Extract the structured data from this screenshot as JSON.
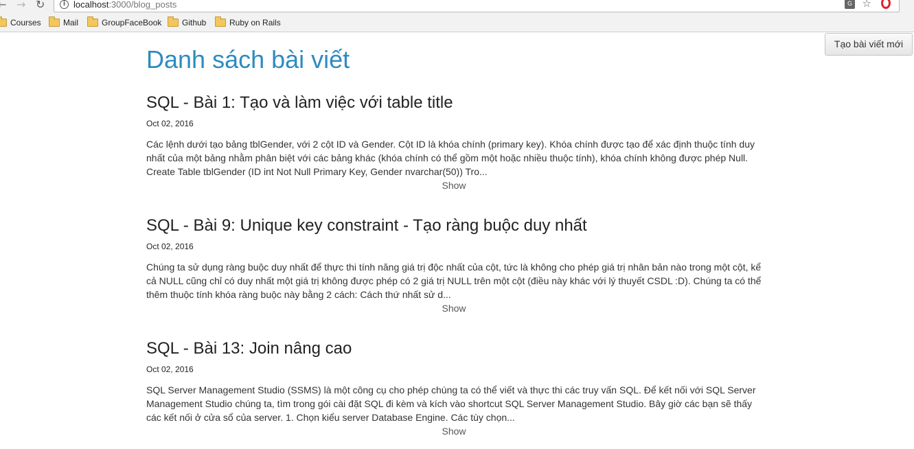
{
  "browser": {
    "url_host": "localhost",
    "url_path": ":3000/blog_posts",
    "bookmarks": [
      "Courses",
      "Mail",
      "GroupFaceBook",
      "Github",
      "Ruby on Rails"
    ]
  },
  "page": {
    "title": "Danh sách bài viết",
    "new_post_button": "Tạo bài viết mới",
    "title_color": "#2e8bc0"
  },
  "posts": [
    {
      "title": "SQL - Bài 1: Tạo và làm việc với table title",
      "date": "Oct 02, 2016",
      "excerpt": "Các lệnh dưới tạo bảng tblGender, với 2 cột ID và Gender. Cột ID là khóa chính (primary key). Khóa chính được tạo để xác định thuộc tính duy nhất của một bảng nhằm phân biệt với các bảng khác (khóa chính có thể gồm một hoặc nhiều thuộc tính), khóa chính không được phép Null. Create Table tblGender (ID int Not Null Primary Key, Gender nvarchar(50)) Tro...",
      "show": "Show"
    },
    {
      "title": "SQL - Bài 9: Unique key constraint - Tạo ràng buộc duy nhất",
      "date": "Oct 02, 2016",
      "excerpt": "Chúng ta sử dụng ràng buộc duy nhất để thực thi tính năng giá trị độc nhất của cột, tức là không cho phép giá trị nhân bản nào trong một cột, kể cả NULL cũng chỉ có duy nhất một giá trị không được phép có 2 giá trị NULL trên một cột (điều này khác với lý thuyết CSDL :D). Chúng ta có thể thêm thuộc tính khóa ràng buộc này bằng 2 cách: Cách thứ nhất sử d...",
      "show": "Show"
    },
    {
      "title": "SQL - Bài 13: Join nâng cao",
      "date": "Oct 02, 2016",
      "excerpt": "SQL Server Management Studio (SSMS) là một công cụ cho phép chúng ta có thể viết và thực thi các truy vấn SQL. Để kết nối với SQL Server Management Studio chúng ta, tìm trong gói cài đặt SQL đi kèm và kích vào shortcut SQL Server Management Studio. Bây giờ các bạn sẽ thấy các kết nối ở cửa sổ của server. 1. Chọn kiểu server Database Engine. Các tùy chọn...",
      "show": "Show"
    }
  ]
}
